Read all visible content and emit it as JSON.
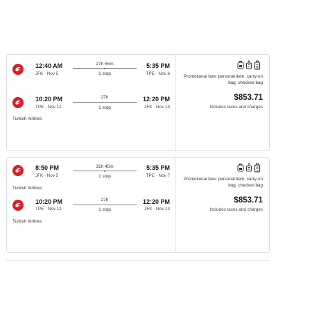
{
  "results": [
    {
      "legs": [
        {
          "dep_time": "12:40 AM",
          "dep_place": "JFK · Nov 5",
          "duration": "27h 55m",
          "stops": "1 stop",
          "arr_time": "5:35 PM",
          "arr_place": "TPE · Nov 6"
        },
        {
          "dep_time": "10:20 PM",
          "dep_place": "TPE · Nov 12",
          "duration": "27h",
          "stops": "1 stop",
          "arr_time": "12:20 PM",
          "arr_place": "JFK · Nov 13"
        }
      ],
      "airline": "Turkish Airlines",
      "fare_text": "Promotional fare: personal item, carry-on bag, checked bag",
      "price": "$853.71",
      "taxes": "Includes taxes and charges"
    },
    {
      "legs": [
        {
          "dep_time": "8:50 PM",
          "dep_place": "JFK · Nov 5",
          "duration": "31h 45m",
          "stops": "1 stop",
          "arr_time": "5:35 PM",
          "arr_place": "TPE · Nov 7"
        },
        {
          "dep_time": "10:20 PM",
          "dep_place": "TPE · Nov 12",
          "duration": "27h",
          "stops": "1 stop",
          "arr_time": "12:20 PM",
          "arr_place": "JFK · Nov 13"
        }
      ],
      "airline": "Turkish Airlines",
      "fare_text": "Promotional fare: personal item, carry-on bag, checked bag",
      "price": "$853.71",
      "taxes": "Includes taxes and charges"
    }
  ],
  "icons": {
    "logo": "turkish-airlines-logo",
    "personal_item": "personal-item-icon",
    "carry_on": "carry-on-bag-icon",
    "checked_bag": "checked-bag-icon"
  },
  "colors": {
    "brand": "#d8202a",
    "border": "#d9dde3"
  }
}
